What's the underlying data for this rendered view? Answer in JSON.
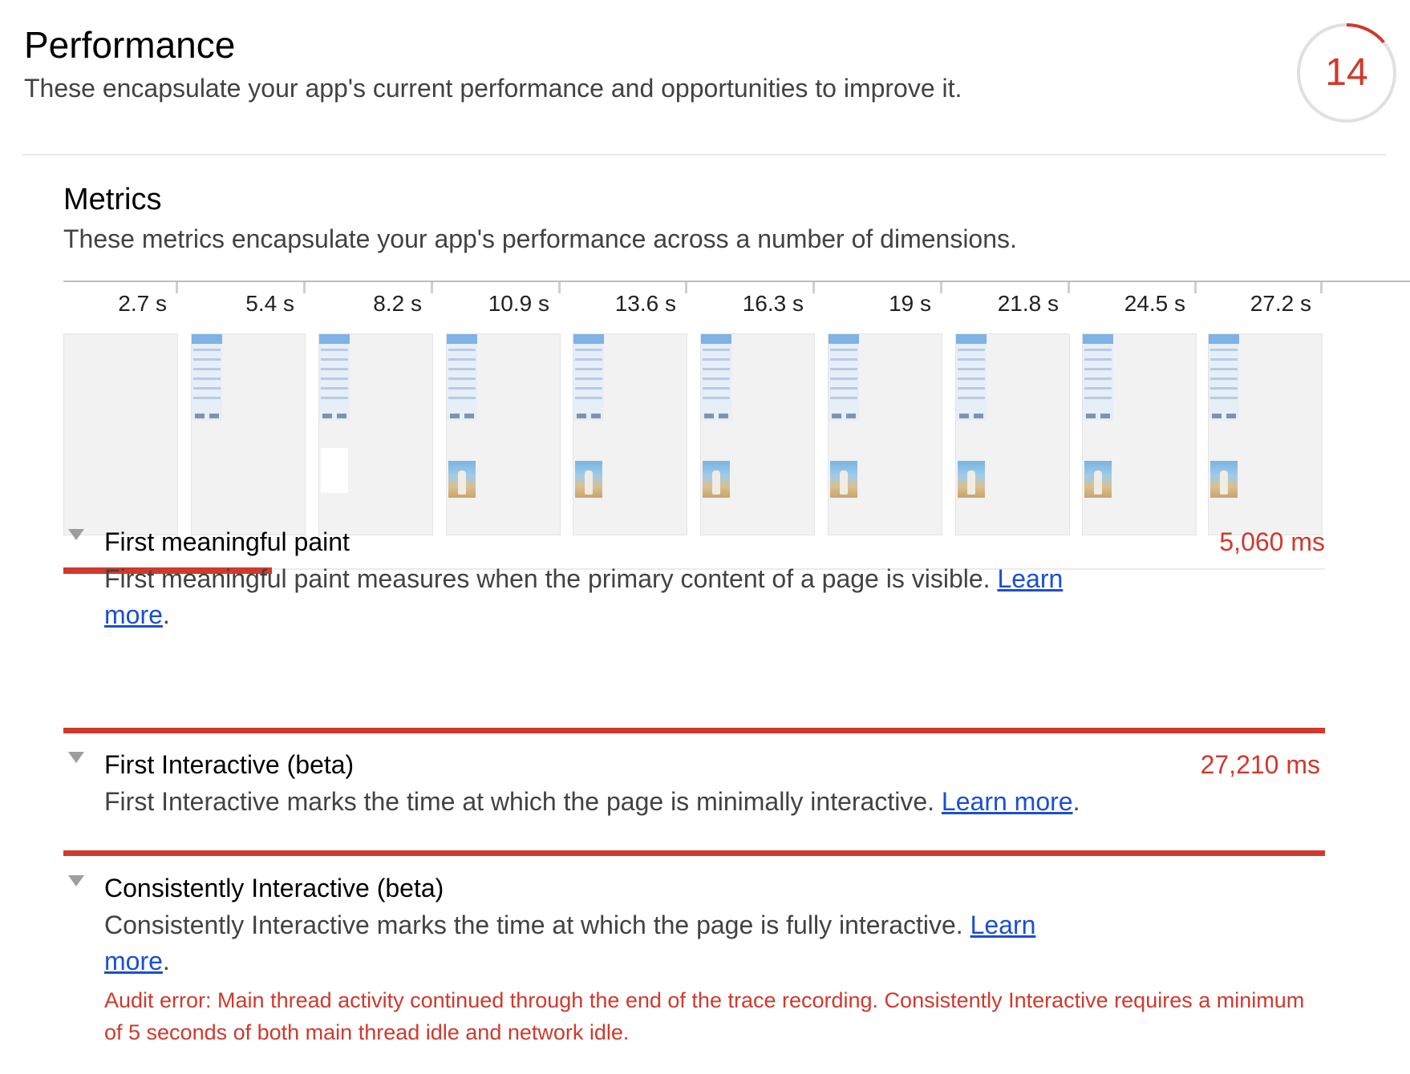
{
  "header": {
    "title": "Performance",
    "description": "These encapsulate your app's current performance and opportunities to improve it.",
    "score": "14",
    "score_fraction": 0.14,
    "score_color": "#d0392d"
  },
  "metrics": {
    "title": "Metrics",
    "description": "These metrics encapsulate your app's performance across a number of dimensions."
  },
  "filmstrip": {
    "frames": [
      {
        "time": "2.7 s",
        "state": "blank"
      },
      {
        "time": "5.4 s",
        "state": "partial"
      },
      {
        "time": "8.2 s",
        "state": "partial-white"
      },
      {
        "time": "10.9 s",
        "state": "full"
      },
      {
        "time": "13.6 s",
        "state": "full"
      },
      {
        "time": "16.3 s",
        "state": "full"
      },
      {
        "time": "19 s",
        "state": "full"
      },
      {
        "time": "21.8 s",
        "state": "full"
      },
      {
        "time": "24.5 s",
        "state": "full"
      },
      {
        "time": "27.2 s",
        "state": "full"
      }
    ]
  },
  "accent_color": "#d0392d",
  "link_color": "#1a4fd1",
  "audits": [
    {
      "title": "First meaningful paint",
      "value": "5,060 ms",
      "description": "First meaningful paint measures when the primary content of a page is visible.",
      "link_first": "Learn",
      "link_second": "more",
      "trailing": "."
    },
    {
      "title": "First Interactive (beta)",
      "value": "27,210 ms",
      "description": "First Interactive marks the time at which the page is minimally interactive.",
      "link": "Learn more",
      "trailing": "."
    },
    {
      "title": "Consistently Interactive (beta)",
      "description": "Consistently Interactive marks the time at which the page is fully interactive.",
      "link_first": "Learn",
      "link_second": "more",
      "trailing": ".",
      "error": "Audit error: Main thread activity continued through the end of the trace recording. Consistently Interactive requires a minimum of 5 seconds of both main thread idle and network idle."
    }
  ]
}
